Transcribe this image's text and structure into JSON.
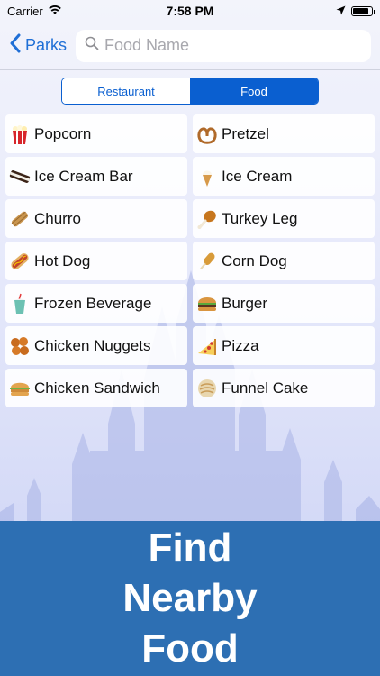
{
  "status": {
    "carrier": "Carrier",
    "time": "7:58 PM",
    "battery_level": 0.85
  },
  "nav": {
    "back_label": "Parks",
    "search_placeholder": "Food Name"
  },
  "segments": {
    "restaurant": "Restaurant",
    "food": "Food",
    "selected": "Food"
  },
  "foods": [
    {
      "label": "Popcorn",
      "icon": "popcorn-icon"
    },
    {
      "label": "Pretzel",
      "icon": "pretzel-icon"
    },
    {
      "label": "Ice Cream Bar",
      "icon": "ice-cream-bar-icon"
    },
    {
      "label": "Ice Cream",
      "icon": "ice-cream-icon"
    },
    {
      "label": "Churro",
      "icon": "churro-icon"
    },
    {
      "label": "Turkey Leg",
      "icon": "turkey-leg-icon"
    },
    {
      "label": "Hot Dog",
      "icon": "hot-dog-icon"
    },
    {
      "label": "Corn Dog",
      "icon": "corn-dog-icon"
    },
    {
      "label": "Frozen Beverage",
      "icon": "frozen-beverage-icon"
    },
    {
      "label": "Burger",
      "icon": "burger-icon"
    },
    {
      "label": "Chicken Nuggets",
      "icon": "chicken-nuggets-icon"
    },
    {
      "label": "Pizza",
      "icon": "pizza-icon"
    },
    {
      "label": "Chicken Sandwich",
      "icon": "chicken-sandwich-icon"
    },
    {
      "label": "Funnel Cake",
      "icon": "funnel-cake-icon"
    }
  ],
  "banner": {
    "line1": "Find",
    "line2": "Nearby",
    "line3": "Food"
  },
  "colors": {
    "accent": "#0a5fd0",
    "back_link": "#1f6fd6",
    "banner": "#2d6fb3"
  }
}
